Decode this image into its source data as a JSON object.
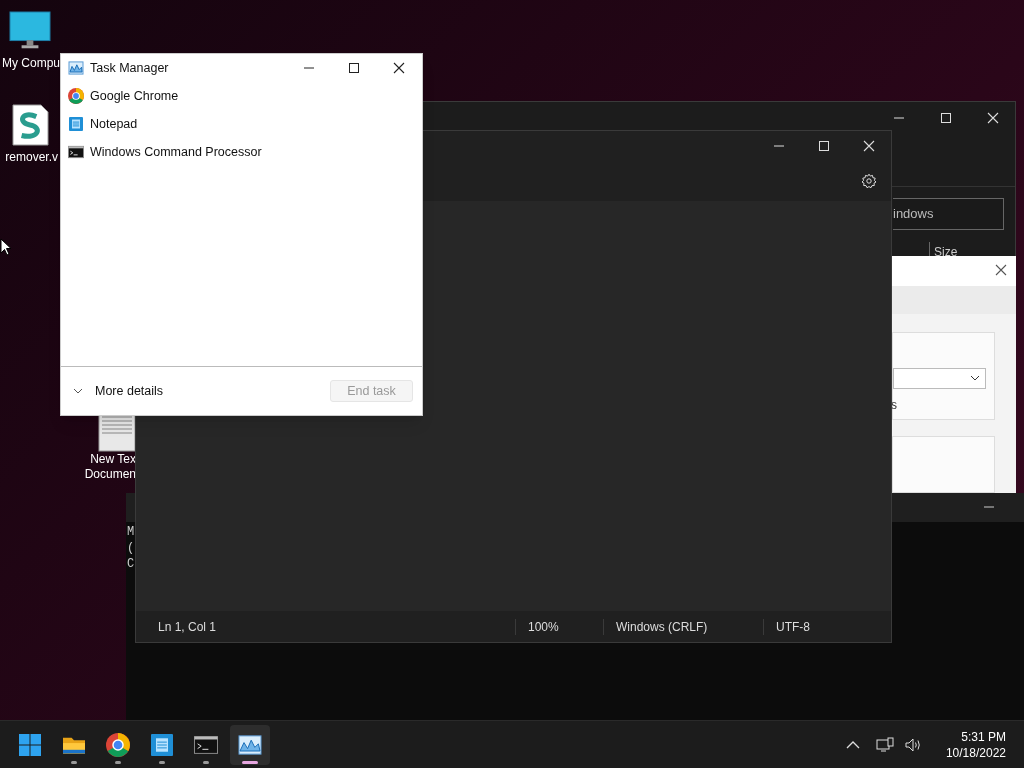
{
  "desktop_icons": [
    {
      "kind": "monitor",
      "label": [
        "My Compu"
      ]
    },
    {
      "kind": "script",
      "label": [
        "remover.v"
      ]
    },
    {
      "kind": "textfile",
      "label": [
        "New Tex",
        "Documen"
      ]
    }
  ],
  "explorer_window": {
    "search_value": "indows",
    "column_header": "Size"
  },
  "dialog": {
    "text": "s"
  },
  "cmd_window": {
    "lines": [
      "M",
      "(",
      "C"
    ]
  },
  "notepad": {
    "status_bar": [
      "Ln 1, Col 1",
      "100%",
      "Windows (CRLF)",
      "UTF-8"
    ]
  },
  "task_manager": {
    "title": "Task Manager",
    "apps": [
      {
        "kind": "chrome",
        "name": "Google Chrome"
      },
      {
        "kind": "notepad",
        "name": "Notepad"
      },
      {
        "kind": "cmd",
        "name": "Windows Command Processor"
      }
    ],
    "more_details": "More details",
    "end_task": {
      "label": "End task",
      "disabled": true
    }
  },
  "taskbar": {
    "apps": [
      {
        "kind": "start",
        "selected": false,
        "running": false
      },
      {
        "kind": "explorer",
        "selected": false,
        "running": true
      },
      {
        "kind": "chrome",
        "selected": false,
        "running": true
      },
      {
        "kind": "notepad",
        "selected": false,
        "running": true
      },
      {
        "kind": "cmd",
        "selected": false,
        "running": true
      },
      {
        "kind": "taskmgr",
        "selected": true,
        "running": true
      }
    ],
    "time": "5:31 PM",
    "date": "10/18/2022"
  }
}
